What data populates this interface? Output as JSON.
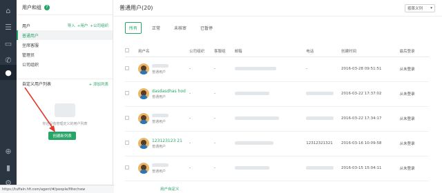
{
  "rail": {
    "icons": [
      "home-icon",
      "list-icon",
      "chat-icon",
      "phone-icon",
      "user-icon",
      "apps-icon",
      "chart-icon",
      "settings-icon"
    ],
    "active_index": 4
  },
  "side": {
    "title": "用户和组",
    "section_label": "用户",
    "section_links": [
      "导入",
      "+用户",
      "+公司组织"
    ],
    "items": [
      "普通用户",
      "坐席客服",
      "管理员",
      "公司组织"
    ],
    "active_index": 0,
    "custom_list_label": "自定义用户列表",
    "custom_add": "+ 添加列表",
    "empty_text": "你还没有管理定义的用户列表",
    "create_button": "创建新列表"
  },
  "main": {
    "title": "普通用户(20)",
    "sort_label": "按首义列"
  },
  "tabs": [
    "所有",
    "正常",
    "未核审",
    "已暂停"
  ],
  "active_tab": 0,
  "table": {
    "headers": [
      "用户名",
      "公司组织",
      "客服组",
      "邮箱",
      "电话",
      "创建时间",
      "最后登录"
    ],
    "rows": [
      {
        "name": "",
        "role": "普通用户",
        "org": "-",
        "group": "-",
        "email": "",
        "phone": "-",
        "created": "2016-03-28 09:51:51",
        "last": "从未登录"
      },
      {
        "name": "dasdasdhas hod",
        "role": "普通用户",
        "org": "-",
        "group": "-",
        "email": "",
        "phone": "",
        "created": "2016-03-22 17:37:02",
        "last": "从未登录"
      },
      {
        "name": "",
        "role": "普通用户",
        "org": "-",
        "group": "-",
        "email": "",
        "phone": "",
        "created": "2016-03-22 17:34:17",
        "last": "从未登录"
      },
      {
        "name": "123123123 21",
        "role": "普通用户",
        "org": "-",
        "group": "-",
        "email": "",
        "phone": "12312321321",
        "created": "2016-03-16 10:09:58",
        "last": "从未登录"
      },
      {
        "name": "",
        "role": "普通用户",
        "org": "-",
        "group": "-",
        "email": "",
        "phone": "",
        "created": "2016-03-15 15:04:11",
        "last": "从未登录"
      }
    ]
  },
  "footer": {
    "link": "用户自定义",
    "status_url": "https://tuffaln.hfi.com/agent/#/people/filter/new"
  },
  "colors": {
    "accent": "#27a567",
    "rail": "#2b3541",
    "arrow": "#e03a2f"
  }
}
